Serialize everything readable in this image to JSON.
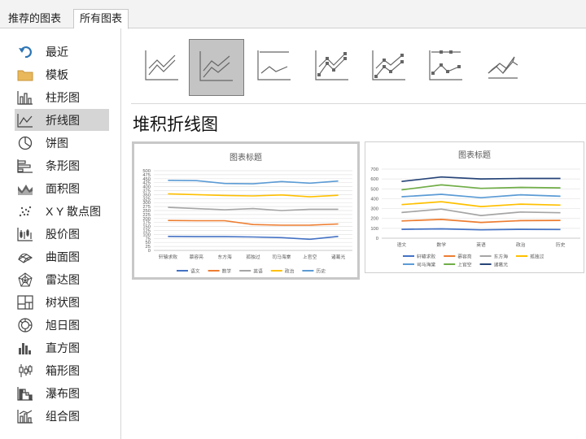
{
  "tabs": [
    {
      "label": "推荐的图表",
      "selected": false
    },
    {
      "label": "所有图表",
      "selected": true
    }
  ],
  "sidebar": {
    "items": [
      {
        "label": "最近",
        "icon": "recent-undo-icon"
      },
      {
        "label": "模板",
        "icon": "folder-icon"
      },
      {
        "label": "柱形图",
        "icon": "column-chart-icon"
      },
      {
        "label": "折线图",
        "icon": "line-chart-icon",
        "selected": true
      },
      {
        "label": "饼图",
        "icon": "pie-chart-icon"
      },
      {
        "label": "条形图",
        "icon": "bar-chart-icon"
      },
      {
        "label": "面积图",
        "icon": "area-chart-icon"
      },
      {
        "label": "X Y 散点图",
        "icon": "scatter-chart-icon"
      },
      {
        "label": "股价图",
        "icon": "stock-chart-icon"
      },
      {
        "label": "曲面图",
        "icon": "surface-chart-icon"
      },
      {
        "label": "雷达图",
        "icon": "radar-chart-icon"
      },
      {
        "label": "树状图",
        "icon": "treemap-chart-icon"
      },
      {
        "label": "旭日图",
        "icon": "sunburst-chart-icon"
      },
      {
        "label": "直方图",
        "icon": "histogram-chart-icon"
      },
      {
        "label": "箱形图",
        "icon": "box-whisker-chart-icon"
      },
      {
        "label": "瀑布图",
        "icon": "waterfall-chart-icon"
      },
      {
        "label": "组合图",
        "icon": "combo-chart-icon"
      }
    ]
  },
  "subtypes": [
    {
      "icon": "line-icon",
      "selected": false
    },
    {
      "icon": "stacked-line-icon",
      "selected": true
    },
    {
      "icon": "percent-stacked-line-icon",
      "selected": false
    },
    {
      "icon": "line-with-markers-icon",
      "selected": false
    },
    {
      "icon": "stacked-line-with-markers-icon",
      "selected": false
    },
    {
      "icon": "percent-stacked-line-with-markers-icon",
      "selected": false
    },
    {
      "icon": "3d-line-icon",
      "selected": false
    }
  ],
  "heading": "堆积折线图",
  "colors": {
    "blue": "#4472c4",
    "orange": "#ed7d31",
    "gray": "#a5a5a5",
    "gold": "#ffc000",
    "lightblue": "#5b9bd5",
    "green": "#70ad47",
    "navy": "#264478",
    "selected_bg": "#d5d5d5"
  },
  "chart_data": [
    {
      "type": "line",
      "title": "图表标题",
      "categories": [
        "轩辕求败",
        "慕容亮",
        "东方海",
        "孤独过",
        "司马海棠",
        "上官空",
        "诸葛光"
      ],
      "ylim": [
        0,
        500
      ],
      "yticks": [
        "0",
        "25",
        "50",
        "75",
        "100",
        "125",
        "150",
        "175",
        "200",
        "225",
        "250",
        "275",
        "300",
        "325",
        "350",
        "375",
        "400",
        "425",
        "450",
        "475",
        "500"
      ],
      "grid": true,
      "legend": "bottom",
      "series": [
        {
          "name": "语文",
          "color": "#4472c4",
          "values": [
            88,
            86,
            86,
            84,
            80,
            70,
            88
          ]
        },
        {
          "name": "数学",
          "color": "#ed7d31",
          "values": [
            188,
            186,
            186,
            162,
            158,
            158,
            166
          ]
        },
        {
          "name": "英语",
          "color": "#a5a5a5",
          "values": [
            270,
            262,
            255,
            262,
            250,
            258,
            258
          ]
        },
        {
          "name": "政治",
          "color": "#ffc000",
          "values": [
            355,
            350,
            345,
            342,
            348,
            336,
            346
          ]
        },
        {
          "name": "历史",
          "color": "#5b9bd5",
          "values": [
            440,
            438,
            420,
            418,
            432,
            422,
            435
          ]
        }
      ]
    },
    {
      "type": "line",
      "title": "图表标题",
      "categories": [
        "语文",
        "数学",
        "英语",
        "政治",
        "历史"
      ],
      "ylim": [
        0,
        700
      ],
      "yticks": [
        "0",
        "100",
        "200",
        "300",
        "400",
        "500",
        "600",
        "700"
      ],
      "grid": true,
      "legend": "bottom",
      "series": [
        {
          "name": "轩辕求败",
          "color": "#4472c4",
          "values": [
            90,
            95,
            85,
            90,
            88
          ]
        },
        {
          "name": "慕容亮",
          "color": "#ed7d31",
          "values": [
            175,
            190,
            160,
            178,
            180
          ]
        },
        {
          "name": "东方海",
          "color": "#a5a5a5",
          "values": [
            260,
            295,
            230,
            265,
            258
          ]
        },
        {
          "name": "孤独过",
          "color": "#ffc000",
          "values": [
            340,
            370,
            320,
            345,
            335
          ]
        },
        {
          "name": "司马海棠",
          "color": "#5b9bd5",
          "values": [
            420,
            445,
            410,
            440,
            425
          ]
        },
        {
          "name": "上官空",
          "color": "#70ad47",
          "values": [
            490,
            540,
            505,
            515,
            510
          ]
        },
        {
          "name": "诸葛光",
          "color": "#264478",
          "values": [
            575,
            620,
            600,
            605,
            605
          ]
        }
      ]
    }
  ]
}
